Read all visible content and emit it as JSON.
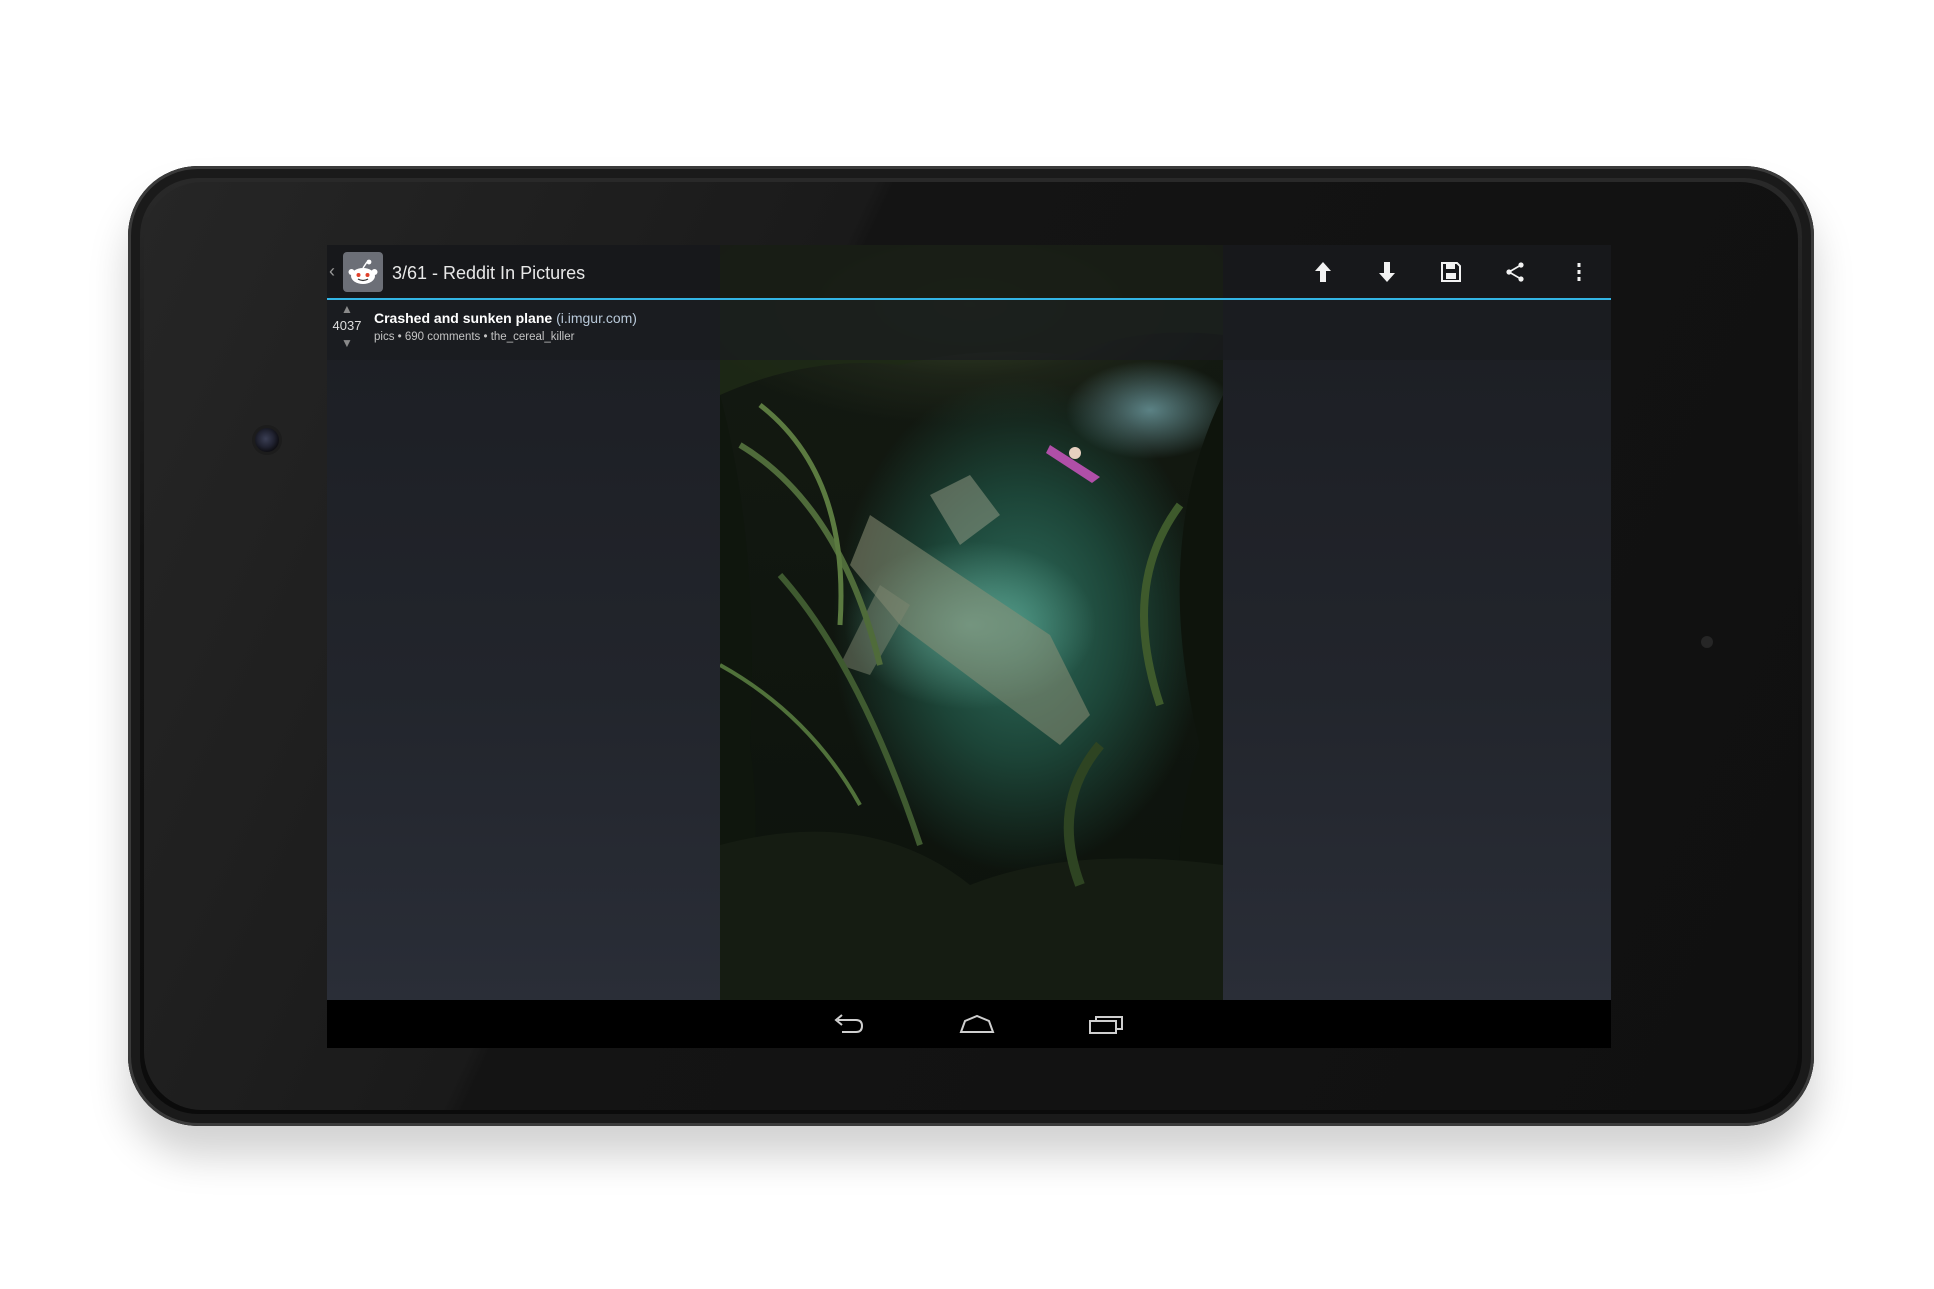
{
  "action_bar": {
    "title": "3/61 - Reddit In Pictures",
    "actions": [
      {
        "icon": "upvote-arrow-icon",
        "name": "upvote-button"
      },
      {
        "icon": "downvote-arrow-icon",
        "name": "downvote-button"
      },
      {
        "icon": "save-icon",
        "name": "save-button"
      },
      {
        "icon": "share-icon",
        "name": "share-button"
      },
      {
        "icon": "overflow-menu-icon",
        "name": "overflow-menu-button"
      }
    ],
    "accent": "#33b5e5"
  },
  "post": {
    "score": "4037",
    "title": "Crashed and sunken plane",
    "domain": "(i.imgur.com)",
    "meta": "pics • 690 comments • the_cereal_killer"
  },
  "navigation": {
    "buttons": [
      "back-icon",
      "home-icon",
      "recent-apps-icon"
    ]
  }
}
